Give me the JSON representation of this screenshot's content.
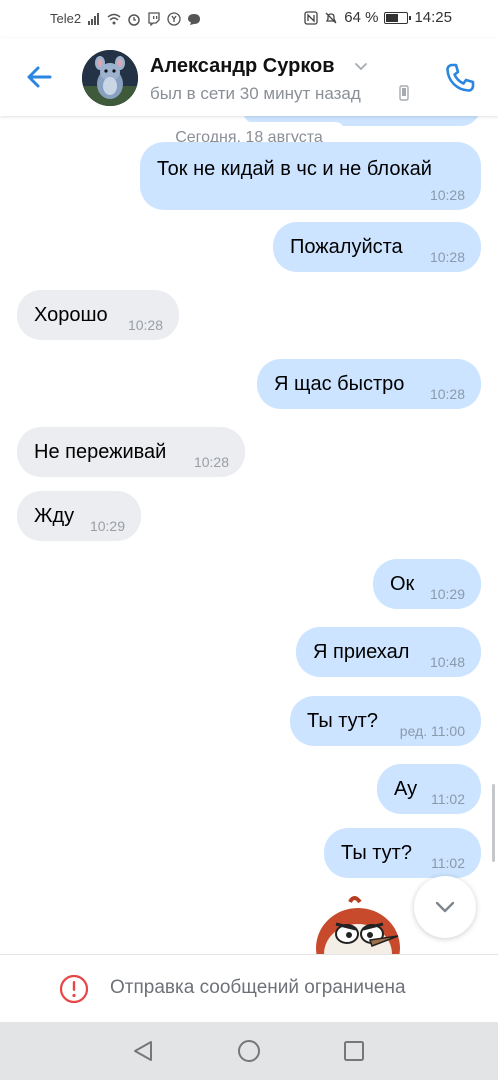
{
  "status_bar": {
    "carrier": "Tele2",
    "battery_percent": "64 %",
    "battery_level": 0.64,
    "time": "14:25"
  },
  "header": {
    "contact_name": "Александр Сурков",
    "last_seen": "был в сети 30 минут назад",
    "accent_color": "#2a86e0"
  },
  "chat": {
    "date_separator": "Сегодня, 18 августа",
    "messages": [
      {
        "dir": "out",
        "text": "Ток не кидай в чс и не блокай",
        "time": "10:28"
      },
      {
        "dir": "out",
        "text": "Пожалуйста",
        "time": "10:28"
      },
      {
        "dir": "in",
        "text": "Хорошо",
        "time": "10:28"
      },
      {
        "dir": "out",
        "text": "Я щас быстро",
        "time": "10:28"
      },
      {
        "dir": "in",
        "text": "Не переживай",
        "time": "10:28"
      },
      {
        "dir": "in",
        "text": "Жду",
        "time": "10:29"
      },
      {
        "dir": "out",
        "text": "Ок",
        "time": "10:29"
      },
      {
        "dir": "out",
        "text": "Я приехал",
        "time": "10:48"
      },
      {
        "dir": "out",
        "text": "Ты тут?",
        "time": "ред. 11:00"
      },
      {
        "dir": "out",
        "text": "Ау",
        "time": "11:02"
      },
      {
        "dir": "out",
        "text": "Ты тут?",
        "time": "11:02"
      }
    ]
  },
  "restriction": {
    "text": "Отправка сообщений ограничена",
    "icon": "alert-circle-icon",
    "icon_color": "#e64646"
  },
  "nav": {
    "back_icon": "triangle-back-icon",
    "home_icon": "circle-home-icon",
    "recent_icon": "square-recent-icon"
  }
}
